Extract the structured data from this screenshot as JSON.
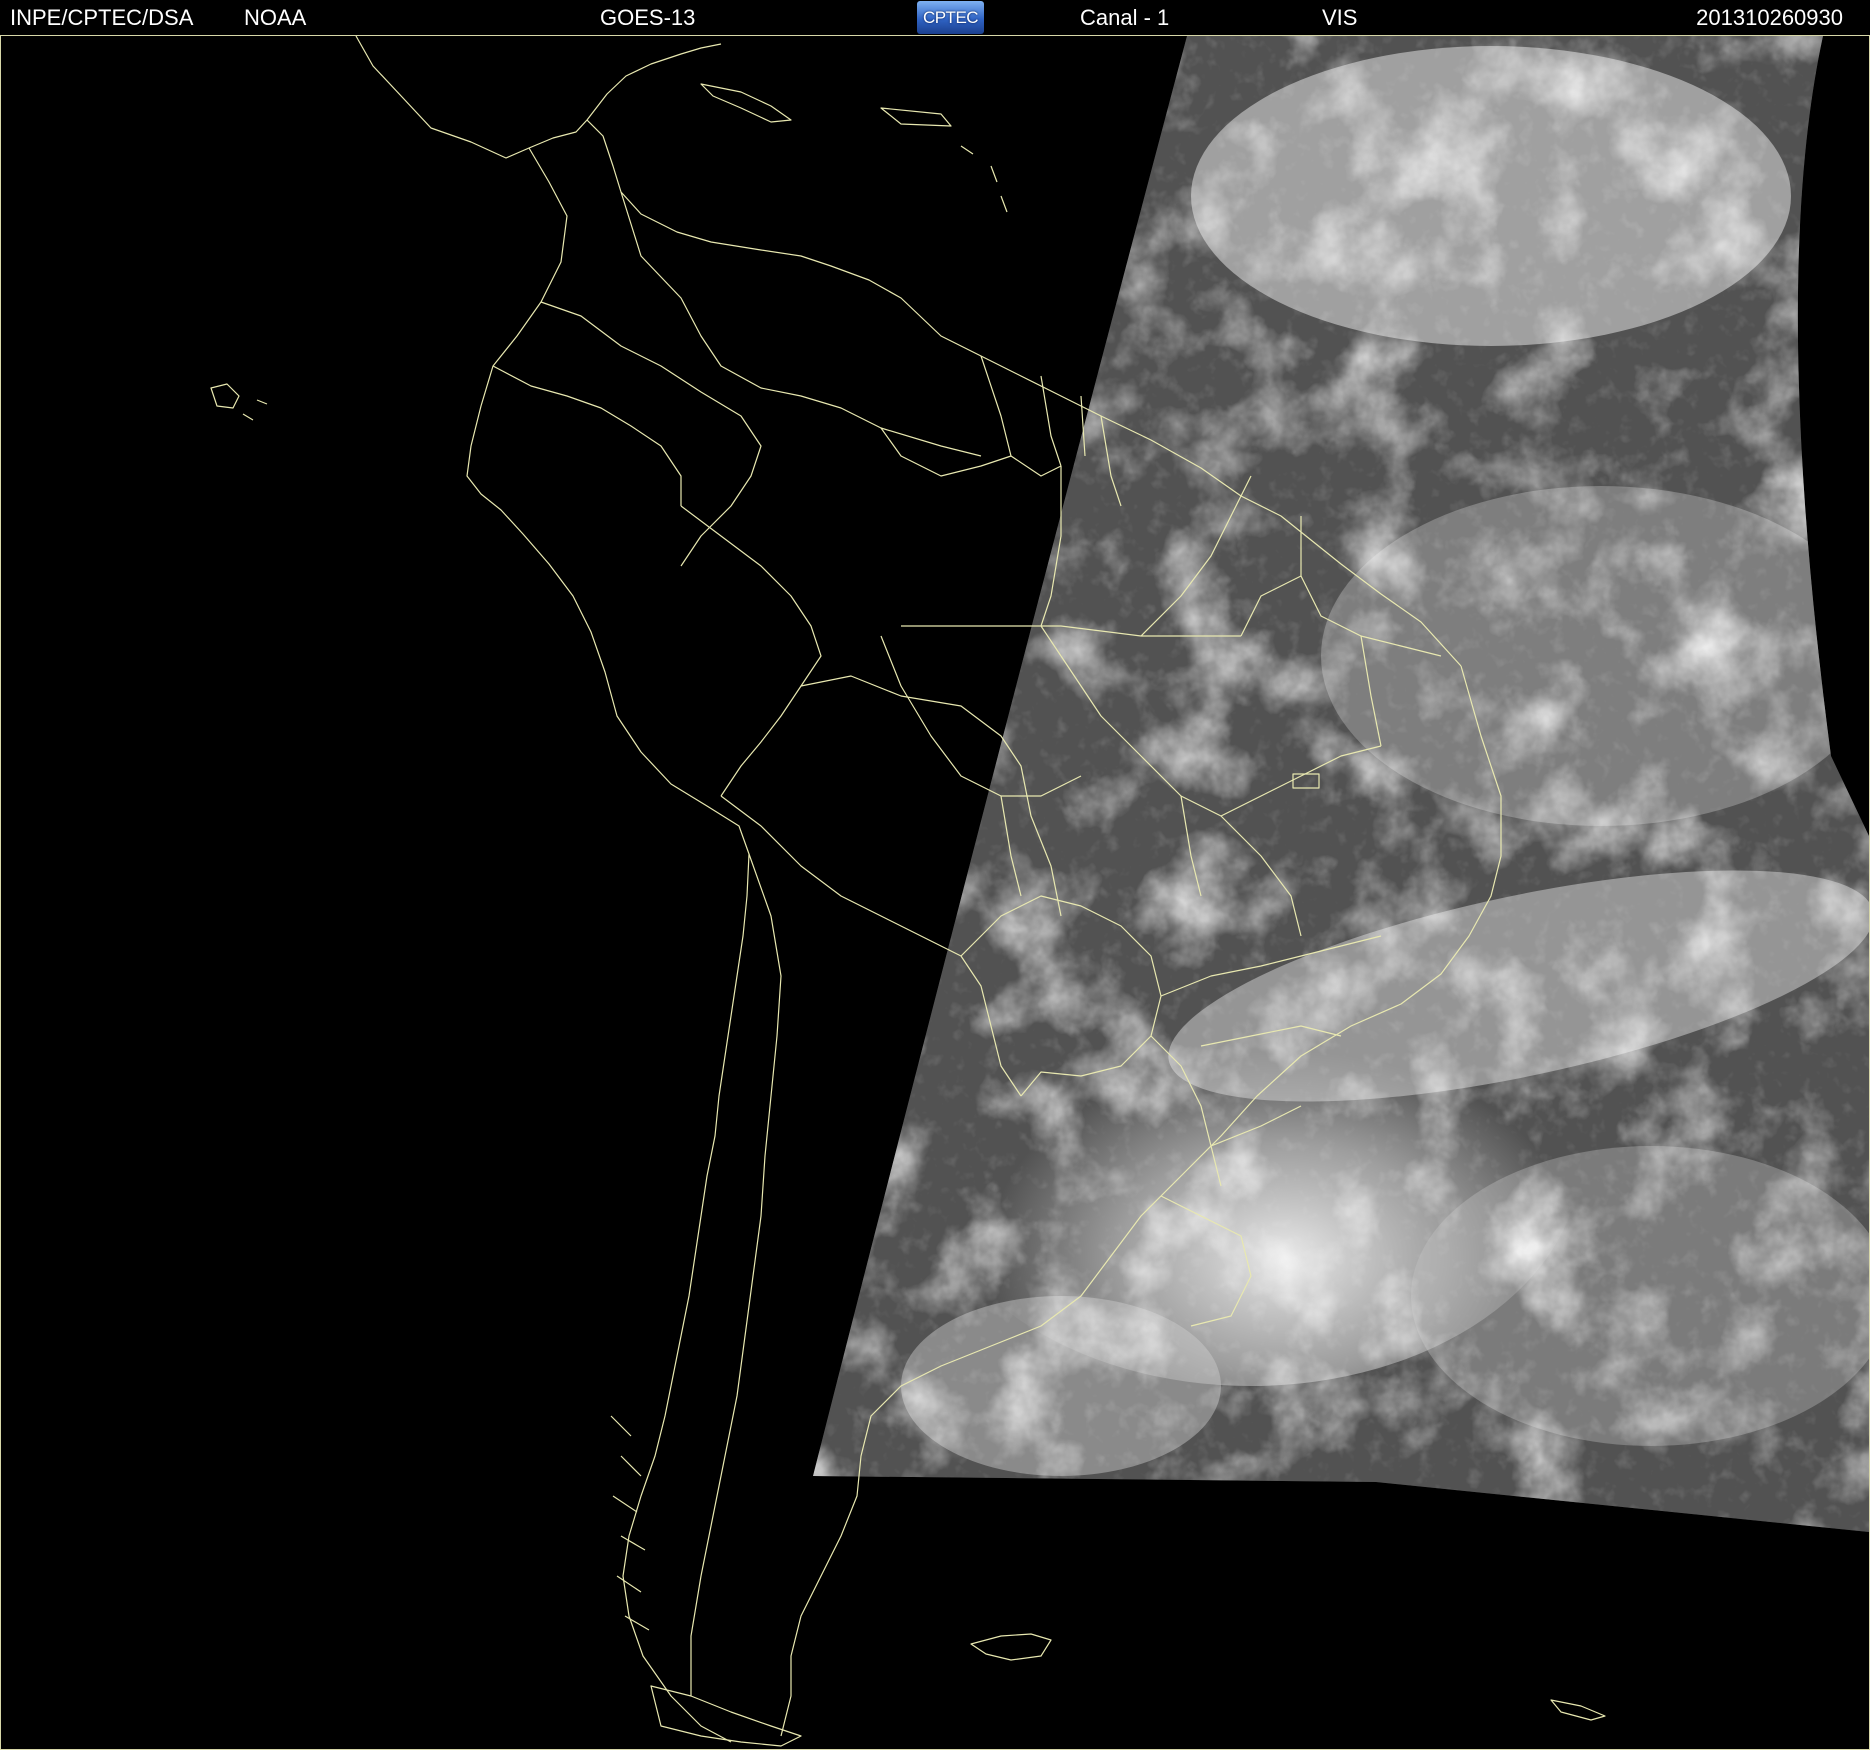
{
  "header": {
    "institution": "INPE/CPTEC/DSA",
    "agency": "NOAA",
    "satellite": "GOES-13",
    "logo_text": "CPTEC",
    "channel": "Canal - 1",
    "band": "VIS",
    "timestamp": "201310260930"
  },
  "colors": {
    "background": "#000000",
    "boundary_lines": "#e8e8b0",
    "header_text": "#ffffff",
    "logo_blue": "#2f63c4"
  },
  "map": {
    "region": "South America",
    "layers": [
      "coastlines",
      "country-borders",
      "state-borders",
      "visible-cloud-imagery"
    ]
  }
}
